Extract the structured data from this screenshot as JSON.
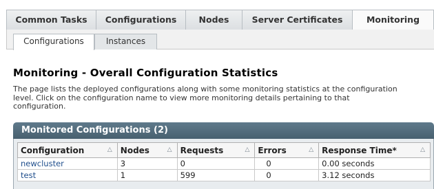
{
  "tabs": [
    {
      "label": "Common Tasks",
      "active": false
    },
    {
      "label": "Configurations",
      "active": false
    },
    {
      "label": "Nodes",
      "active": false
    },
    {
      "label": "Server Certificates",
      "active": false
    },
    {
      "label": "Monitoring",
      "active": true
    }
  ],
  "subtabs": [
    {
      "label": "Configurations",
      "active": true
    },
    {
      "label": "Instances",
      "active": false
    }
  ],
  "page": {
    "title": "Monitoring - Overall Configuration Statistics",
    "help_line1": "The page lists the deployed configurations along with some monitoring statistics at the configuration",
    "help_line2": "level. Click on the configuration name to view more monitoring details pertaining to that",
    "help_line3": "configuration."
  },
  "panel": {
    "title": "Monitored Configurations (2)"
  },
  "table": {
    "columns": [
      "Configuration",
      "Nodes",
      "Requests",
      "Errors",
      "Response Time*"
    ],
    "rows": [
      {
        "configuration": "newcluster",
        "nodes": "3",
        "requests": "0",
        "errors": "0",
        "response_time": "0.00 seconds"
      },
      {
        "configuration": "test",
        "nodes": "1",
        "requests": "599",
        "errors": "0",
        "response_time": "3.12 seconds"
      }
    ]
  },
  "icons": {
    "sort": "sort-ascending-icon"
  },
  "colors": {
    "panel_header": "#54707f",
    "link": "#1f4e8c"
  }
}
